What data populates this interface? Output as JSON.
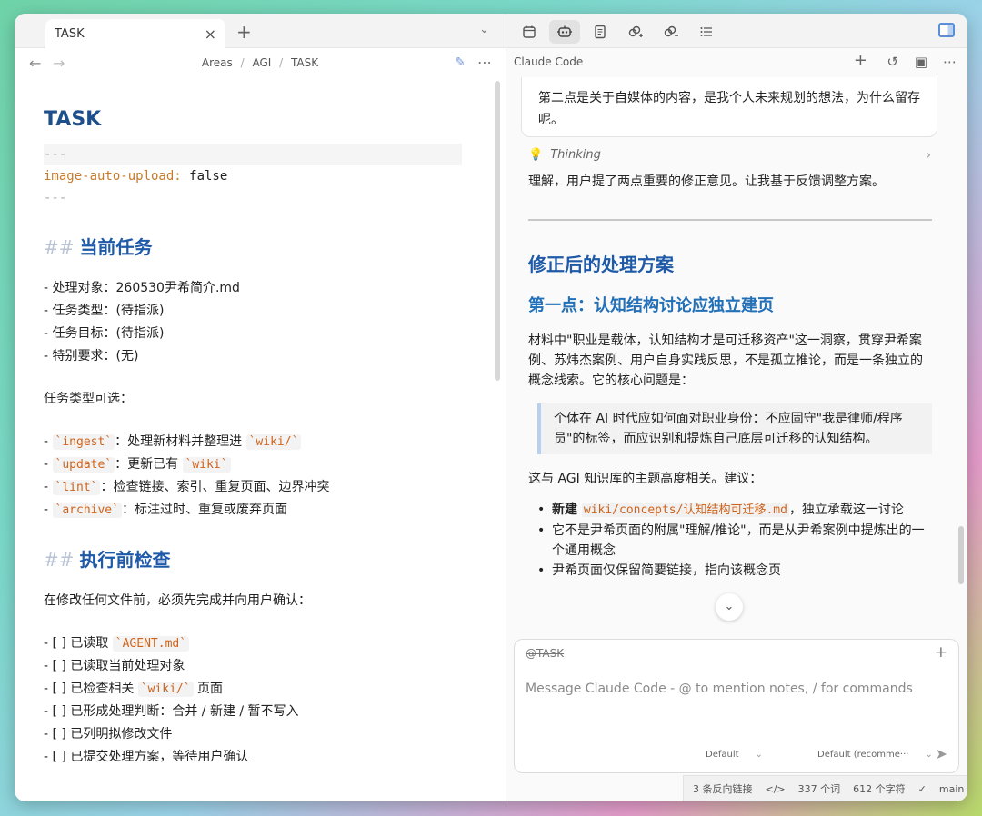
{
  "left": {
    "tab": {
      "label": "TASK",
      "close": "×",
      "new": "+",
      "menu": "⌄"
    },
    "nav": {
      "back": "←",
      "forward": "→",
      "crumbs": [
        "Areas",
        "AGI",
        "TASK"
      ],
      "sep": "/",
      "edit": "✎",
      "more": "⋯"
    },
    "doc": {
      "title": "TASK",
      "fm_dash": "---",
      "fm_key": "image-auto-upload:",
      "fm_value": " false",
      "h2_hash": "##",
      "section1": "当前任务",
      "items1": [
        "- 处理对象：260530尹希简介.md",
        "- 任务类型：(待指派)",
        "- 任务目标：(待指派)",
        "- 特别要求：(无)"
      ],
      "types_heading": "任务类型可选：",
      "types": [
        {
          "code": "`ingest`",
          "text": "：处理新材料并整理进 ",
          "code2": "`wiki/`",
          "tail": ""
        },
        {
          "code": "`update`",
          "text": "：更新已有 ",
          "code2": "`wiki`",
          "tail": ""
        },
        {
          "code": "`lint`",
          "text": "：检查链接、索引、重复页面、边界冲突",
          "code2": "",
          "tail": ""
        },
        {
          "code": "`archive`",
          "text": "：标注过时、重复或废弃页面",
          "code2": "",
          "tail": ""
        }
      ],
      "section2": "执行前检查",
      "check_intro": "在修改任何文件前，必须先完成并向用户确认：",
      "checks": [
        {
          "pre": "- [ ] 已读取 ",
          "code": "`AGENT.md`",
          "post": ""
        },
        {
          "pre": "- [ ] 已读取当前处理对象",
          "code": "",
          "post": ""
        },
        {
          "pre": "- [ ] 已检查相关 ",
          "code": "`wiki/`",
          "post": " 页面"
        },
        {
          "pre": "- [ ] 已形成处理判断：合并 / 新建 / 暂不写入",
          "code": "",
          "post": ""
        },
        {
          "pre": "- [ ] 已列明拟修改文件",
          "code": "",
          "post": ""
        },
        {
          "pre": "- [ ] 已提交处理方案，等待用户确认",
          "code": "",
          "post": ""
        }
      ]
    }
  },
  "right": {
    "toolbar_icons": [
      "calendar-icon",
      "robot-icon",
      "document-icon",
      "link-add-icon",
      "link-remove-icon",
      "list-icon"
    ],
    "header": {
      "title": "Claude Code",
      "plus": "+",
      "history": "↺",
      "save": "▣",
      "more": "⋯"
    },
    "user_msg": "第二点是关于自媒体的内容，是我个人未来规划的想法，为什么留存呢。",
    "thinking": "Thinking",
    "reply_intro": "理解，用户提了两点重要的修正意见。让我基于反馈调整方案。",
    "h1": "修正后的处理方案",
    "h2": "第一点：认知结构讨论应独立建页",
    "para1": "材料中\"职业是载体，认知结构才是可迁移资产\"这一洞察，贯穿尹希案例、苏炜杰案例、用户自身实践反思，不是孤立推论，而是一条独立的概念线索。它的核心问题是：",
    "quote": "个体在 AI 时代应如何面对职业身份：不应固守\"我是律师/程序员\"的标签，而应识别和提炼自己底层可迁移的认知结构。",
    "para2": "这与 AGI 知识库的主题高度相关。建议：",
    "bullets": [
      {
        "bold": "新建 ",
        "code": "wiki/concepts/认知结构可迁移.md",
        "text": "，独立承载这一讨论"
      },
      {
        "bold": "",
        "code": "",
        "text": "它不是尹希页面的附属\"理解/推论\"，而是从尹希案例中提炼出的一个通用概念"
      },
      {
        "bold": "",
        "code": "",
        "text": "尹希页面仅保留简要链接，指向该概念页"
      }
    ],
    "scroll_down": "⌄",
    "composer": {
      "mention": "@TASK",
      "plus": "+",
      "placeholder": "Message Claude Code - @ to mention notes, / for commands",
      "model": "Default",
      "mode": "Default (recomme···",
      "send": "➤"
    },
    "status": {
      "backlinks": "3 条反向链接",
      "code": "</>",
      "words": "337 个词",
      "chars": "612 个字符",
      "check": "✓",
      "branch": "main"
    }
  }
}
